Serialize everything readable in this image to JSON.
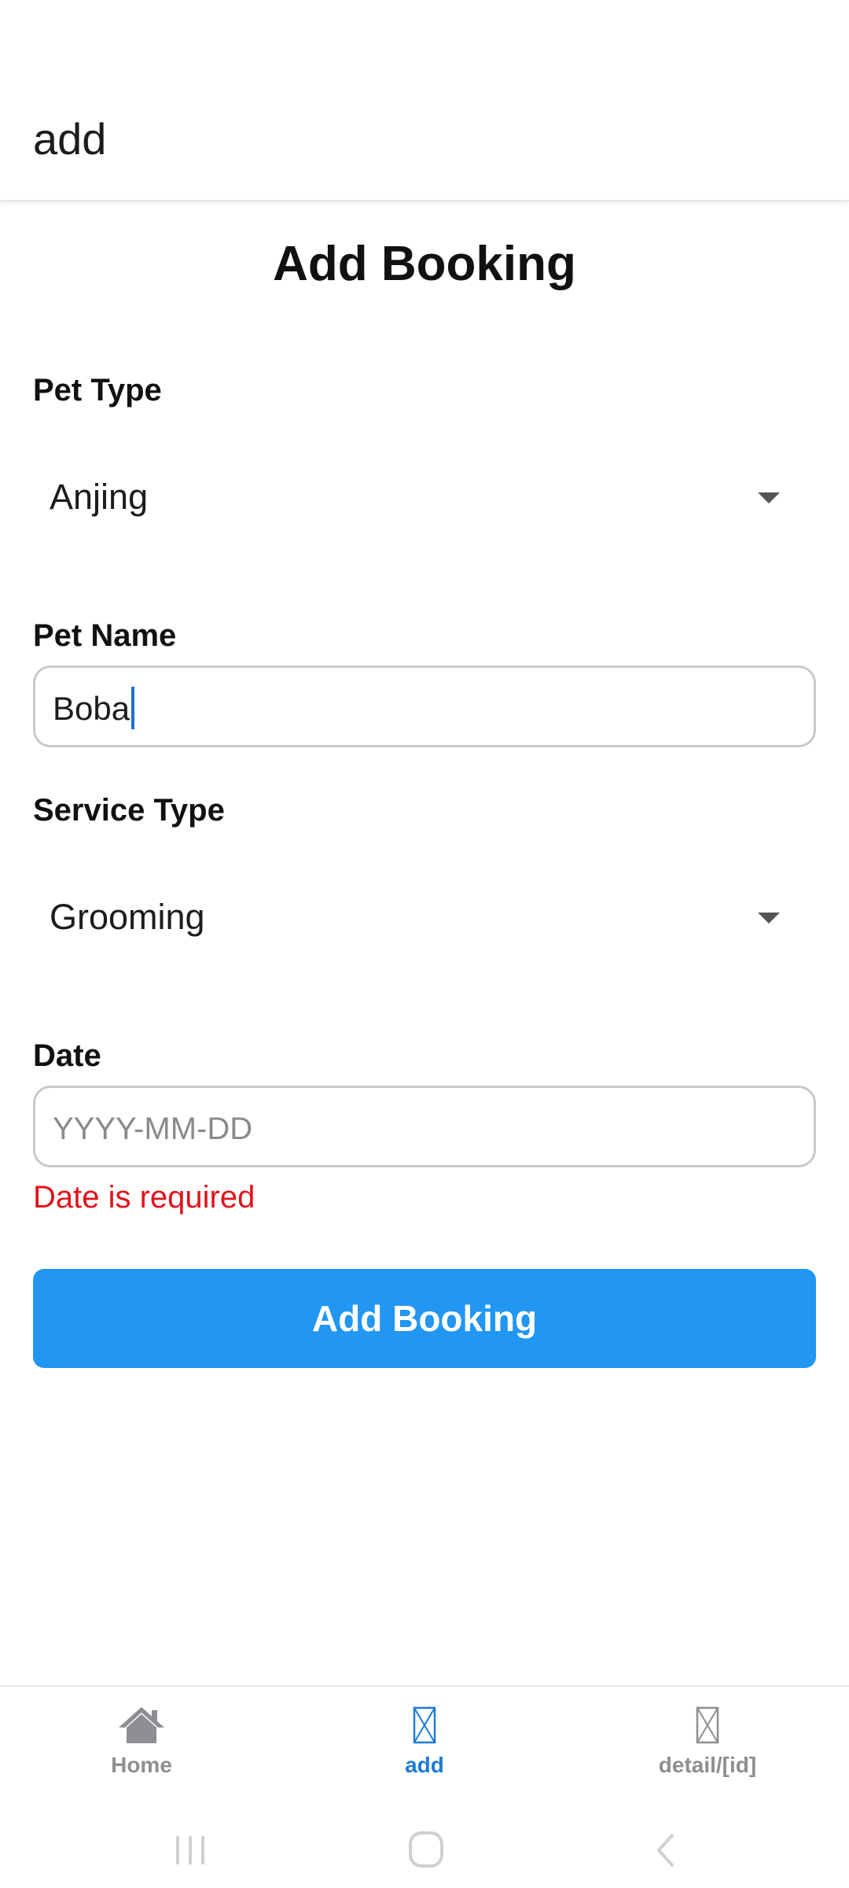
{
  "header": {
    "title": "add"
  },
  "form": {
    "heading": "Add Booking",
    "pet_type": {
      "label": "Pet Type",
      "selected": "Anjing"
    },
    "pet_name": {
      "label": "Pet Name",
      "value": "Boba"
    },
    "service_type": {
      "label": "Service Type",
      "selected": "Grooming"
    },
    "date": {
      "label": "Date",
      "placeholder": "YYYY-MM-DD",
      "value": "",
      "error": "Date is required"
    },
    "submit_label": "Add Booking"
  },
  "tabs": [
    {
      "label": "Home",
      "icon": "home-icon",
      "active": false
    },
    {
      "label": "add",
      "icon": "missing-glyph-icon",
      "active": true
    },
    {
      "label": "detail/[id]",
      "icon": "missing-glyph-icon",
      "active": false
    }
  ],
  "colors": {
    "accent": "#2196f3",
    "active_tab": "#1e7bd6",
    "inactive_tab": "#8e8e93",
    "error": "#e0141b",
    "input_border": "#c9c9c9"
  },
  "system_nav": {
    "icons": [
      "recent-apps-icon",
      "home-circle-icon",
      "back-icon"
    ]
  }
}
